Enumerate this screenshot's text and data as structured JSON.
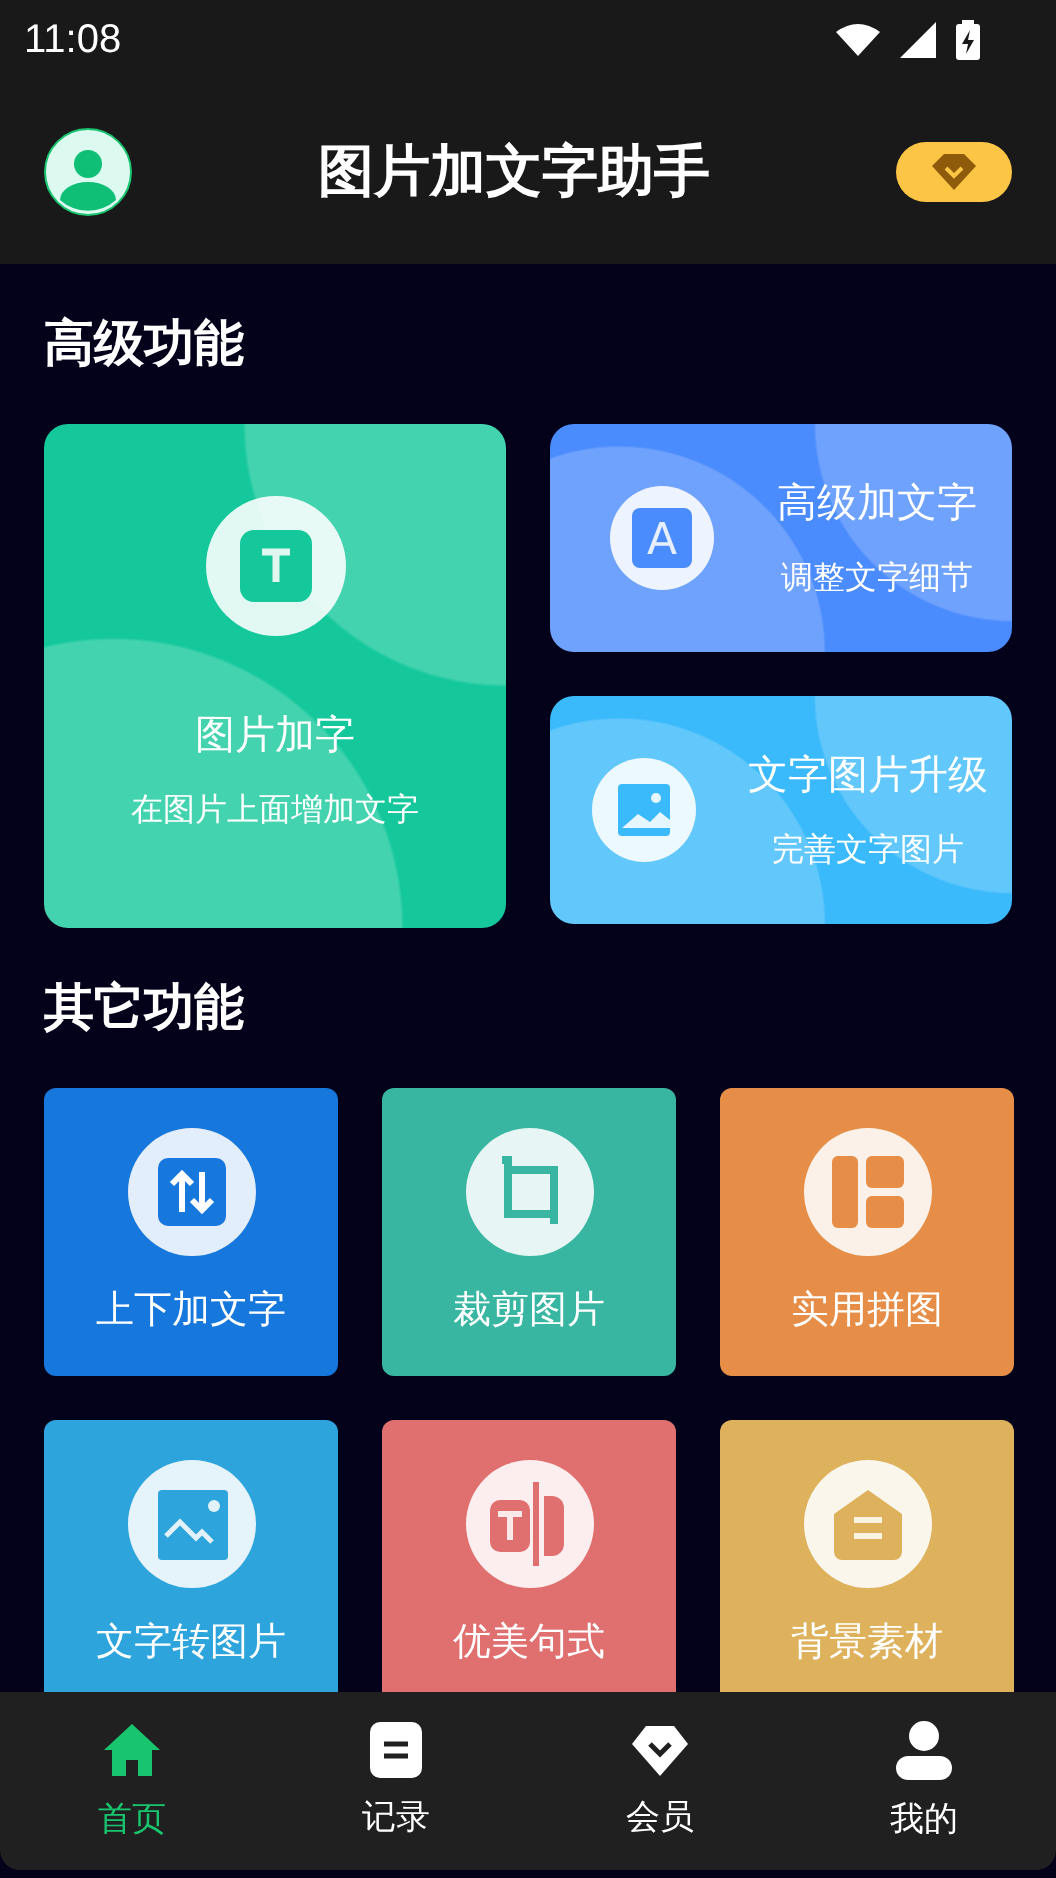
{
  "status_bar": {
    "time": "11:08"
  },
  "header": {
    "title": "图片加文字助手"
  },
  "sections": [
    {
      "title": "高级功能"
    },
    {
      "title": "其它功能"
    }
  ],
  "featured": [
    {
      "kind": "text",
      "title": "图片加字",
      "subtitle": "在图片上面增加文字",
      "color": "#14c89b"
    },
    {
      "kind": "letter",
      "title": "高级加文字",
      "subtitle": "调整文字细节",
      "color": "#4a8bfd",
      "letter": "A"
    },
    {
      "kind": "image",
      "title": "文字图片升级",
      "subtitle": "完善文字图片",
      "color": "#3bbafb"
    }
  ],
  "tools": [
    {
      "kind": "swap",
      "label": "上下加文字",
      "color": "#1677dd"
    },
    {
      "kind": "crop",
      "label": "裁剪图片",
      "color": "#38b6a2"
    },
    {
      "kind": "collage",
      "label": "实用拼图",
      "color": "#e68e47"
    },
    {
      "kind": "image",
      "label": "文字转图片",
      "color": "#2ea4dd"
    },
    {
      "kind": "split",
      "label": "优美句式",
      "color": "#e07070"
    },
    {
      "kind": "material",
      "label": "背景素材",
      "color": "#deb25d"
    }
  ],
  "nav": [
    {
      "kind": "home",
      "label": "首页",
      "selected": true
    },
    {
      "kind": "record",
      "label": "记录",
      "selected": false
    },
    {
      "kind": "vip",
      "label": "会员",
      "selected": false
    },
    {
      "kind": "me",
      "label": "我的",
      "selected": false
    }
  ]
}
